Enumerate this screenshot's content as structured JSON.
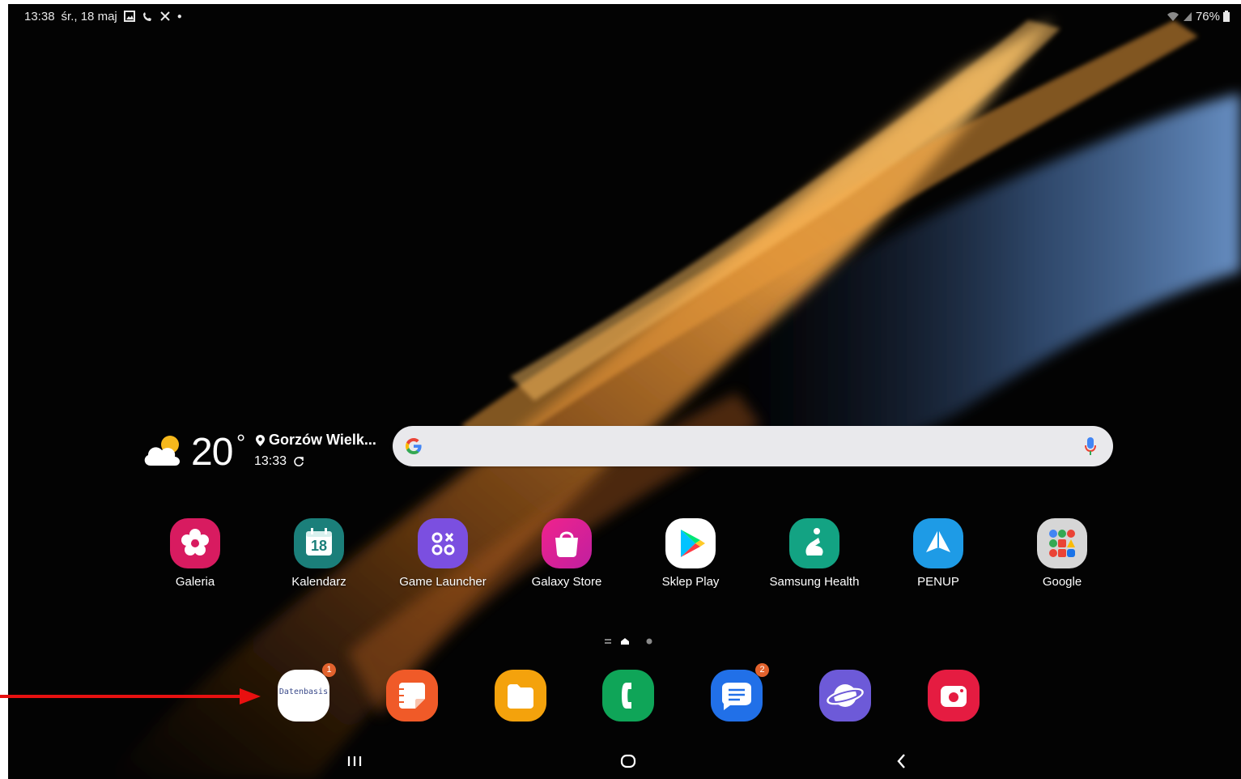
{
  "status_bar": {
    "time": "13:38",
    "date": "śr., 18 maj",
    "battery": "76%"
  },
  "weather": {
    "temperature": "20",
    "degree_symbol": "°",
    "location": "Gorzów Wielk...",
    "updated_time": "13:33",
    "icon": "partly-cloudy-icon"
  },
  "search": {
    "placeholder": "",
    "logo": "google-g-icon",
    "mic": "microphone-icon"
  },
  "apps": [
    {
      "label": "Galeria",
      "icon": "flower-icon",
      "color": "#d81b60"
    },
    {
      "label": "Kalendarz",
      "icon": "calendar-icon",
      "color": "#1b7f7a",
      "day": "18"
    },
    {
      "label": "Game Launcher",
      "icon": "game-launcher-icon",
      "color": "#7b4fe0"
    },
    {
      "label": "Galaxy Store",
      "icon": "shopping-bag-icon",
      "color": "#e91e63"
    },
    {
      "label": "Sklep Play",
      "icon": "play-store-icon",
      "color": "#ffffff"
    },
    {
      "label": "Samsung Health",
      "icon": "health-icon",
      "color": "#13a383"
    },
    {
      "label": "PENUP",
      "icon": "penup-icon",
      "color": "#1e9be6"
    },
    {
      "label": "Google",
      "icon": "folder-icon",
      "color": "#d6d6d6"
    }
  ],
  "dock": [
    {
      "name": "datenbasis-app",
      "label": "Datenbasis",
      "badge": "1",
      "color": "#ffffff"
    },
    {
      "name": "notes-app",
      "icon": "notes-icon",
      "color": "#f05a28"
    },
    {
      "name": "files-app",
      "icon": "folder-icon",
      "color": "#f4a20c"
    },
    {
      "name": "phone-app",
      "icon": "phone-icon",
      "color": "#0fa558"
    },
    {
      "name": "messages-app",
      "icon": "message-icon",
      "badge": "2",
      "color": "#2170e8"
    },
    {
      "name": "internet-app",
      "icon": "planet-icon",
      "color": "#6d5ad8"
    },
    {
      "name": "camera-app",
      "icon": "camera-icon",
      "color": "#e51c41"
    }
  ],
  "navigation": {
    "recents": "recents-icon",
    "home": "home-icon",
    "back": "back-icon"
  },
  "annotation": {
    "arrow_color": "#e81010"
  }
}
